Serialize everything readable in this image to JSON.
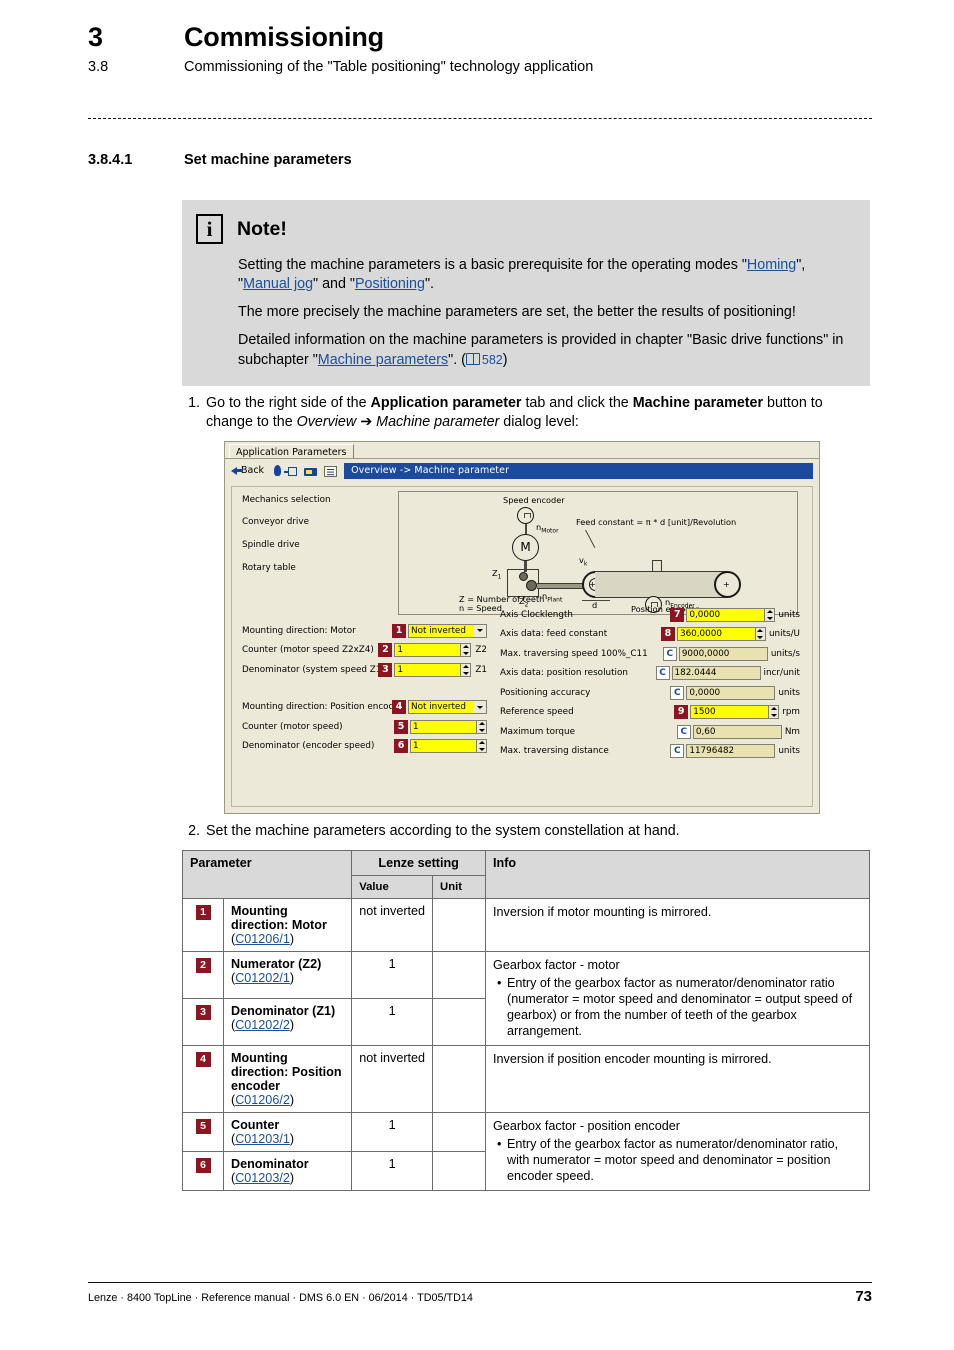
{
  "header": {
    "chapter_number": "3",
    "chapter_title": "Commissioning",
    "section_number": "3.8",
    "section_title": "Commissioning of the \"Table positioning\" technology application"
  },
  "subsection": {
    "number": "3.8.4.1",
    "title": "Set machine parameters"
  },
  "note": {
    "icon": "info-icon",
    "title": "Note!",
    "p1_a": "Setting the machine parameters is a basic prerequisite for the operating modes \"",
    "link_homing": "Homing",
    "p1_b": "\", \"",
    "link_manual_jog": "Manual jog",
    "p1_c": "\" and \"",
    "link_positioning": "Positioning",
    "p1_d": "\".",
    "p2": "The more precisely the machine parameters are set, the better the results of positioning!",
    "p3_a": "Detailed information on the machine parameters is provided in chapter \"Basic drive functions\" in subchapter \"",
    "link_machine_parameters": "Machine parameters",
    "p3_b": "\". (",
    "page_ref": "582",
    "p3_c": ")"
  },
  "steps": {
    "one": {
      "number": "1.",
      "t1": "Go to the right side of the ",
      "b1": "Application parameter",
      "t2": " tab and click the ",
      "b2": "Machine parameter",
      "t3": " button to change to the ",
      "i1": "Overview",
      "t4": " ➔ ",
      "i2": "Machine parameter",
      "t5": " dialog level:"
    },
    "two": {
      "number": "2.",
      "text": "Set the machine parameters according to the system constellation at hand."
    }
  },
  "screenshot": {
    "tab_label": "Application Parameters",
    "toolbar": {
      "back_label": "Back",
      "icons": [
        "back-arrow-icon",
        "bulb-icon",
        "plug-icon",
        "card-icon",
        "properties-icon"
      ],
      "title_bar": "Overview -> Machine parameter",
      "title_bar_color": "#1c4aa0"
    },
    "mechanics": {
      "heading": "Mechanics selection",
      "items": [
        {
          "label": "Conveyor drive",
          "button": "?"
        },
        {
          "label": "Spindle drive",
          "button": "?"
        },
        {
          "label": "Rotary table",
          "button": "?"
        }
      ]
    },
    "diagram": {
      "speed_encoder": "Speed encoder",
      "n_motor": "n",
      "n_motor_sub": "Motor",
      "motor": "M",
      "z1": "Z",
      "z1_sub": "1",
      "z2": "Z",
      "z2_sub": "2",
      "n_plant": "n",
      "n_plant_sub": "Plant",
      "n_encoder": "n",
      "n_encoder_sub": "Encoder",
      "vk": "v",
      "vk_sub": "k",
      "d": "d",
      "position_encoder": "Position encoder",
      "formula": "Feed constant = π * d [unit]/Revolution",
      "legend1": "Z = Number of teeth",
      "legend2": "n = Speed"
    },
    "left_fields": [
      {
        "badge": "1",
        "label": "Mounting direction: Motor",
        "value": "Not inverted",
        "control": "combo",
        "suffix": ""
      },
      {
        "badge": "2",
        "label": "Counter (motor speed Z2xZ4)",
        "value": "1",
        "control": "spin",
        "suffix": "Z2"
      },
      {
        "badge": "3",
        "label": "Denominator (system speed Z1xZ3)",
        "value": "1",
        "control": "spin",
        "suffix": "Z1"
      },
      {
        "badge": "4",
        "label": "Mounting direction: Position encod..",
        "value": "Not inverted",
        "control": "combo",
        "suffix": ""
      },
      {
        "badge": "5",
        "label": "Counter (motor speed)",
        "value": "1",
        "control": "spin",
        "suffix": ""
      },
      {
        "badge": "6",
        "label": "Denominator (encoder speed)",
        "value": "1",
        "control": "spin",
        "suffix": ""
      }
    ],
    "right_fields": [
      {
        "badge": "7",
        "badge_type": "num",
        "label": "Axis Clocklength",
        "value": "0,0000",
        "control": "spin",
        "unit": "units"
      },
      {
        "badge": "8",
        "badge_type": "num",
        "label": "Axis data: feed constant",
        "value": "360,0000",
        "control": "spin",
        "unit": "units/U"
      },
      {
        "badge": "C",
        "badge_type": "c",
        "label": "Max. traversing speed 100%_C11",
        "value": "9000,0000",
        "control": "none",
        "unit": "units/s"
      },
      {
        "badge": "C",
        "badge_type": "c",
        "label": "Axis data: position resolution",
        "value": "182.0444",
        "control": "none",
        "unit": "incr/unit"
      },
      {
        "badge": "C",
        "badge_type": "c",
        "label": "Positioning accuracy",
        "value": "0,0000",
        "control": "none",
        "unit": "units"
      },
      {
        "badge": "9",
        "badge_type": "num",
        "label": "Reference speed",
        "value": "1500",
        "control": "spin",
        "unit": "rpm"
      },
      {
        "badge": "C",
        "badge_type": "c",
        "label": "Maximum torque",
        "value": "0,60",
        "control": "none",
        "unit": "Nm"
      },
      {
        "badge": "C",
        "badge_type": "c",
        "label": "Max. traversing distance",
        "value": "11796482",
        "control": "none",
        "unit": "units"
      }
    ]
  },
  "table": {
    "headers": {
      "parameter": "Parameter",
      "lenze_setting": "Lenze setting",
      "value": "Value",
      "unit": "Unit",
      "info": "Info"
    },
    "rows": [
      {
        "badge": "1",
        "name": "Mounting direction: Motor",
        "code": "C01206/1",
        "value": "not inverted",
        "unit": "",
        "info_title": "Inversion if motor mounting is mirrored.",
        "bullets": []
      },
      {
        "badge": "2",
        "name": "Numerator (Z2)",
        "code": "C01202/1",
        "value": "1",
        "unit": "",
        "info_title": "Gearbox factor - motor",
        "bullets": [
          "Entry of the gearbox factor as numerator/denominator ratio (numerator = motor speed and denominator = output speed of gearbox) or from the number of teeth of the gearbox arrangement."
        ]
      },
      {
        "badge": "3",
        "name": "Denominator (Z1)",
        "code": "C01202/2",
        "value": "1",
        "unit": "",
        "info_title": "",
        "bullets": []
      },
      {
        "badge": "4",
        "name": "Mounting direction: Position encoder",
        "code": "C01206/2",
        "value": "not inverted",
        "unit": "",
        "info_title": "Inversion if position encoder mounting is mirrored.",
        "bullets": []
      },
      {
        "badge": "5",
        "name": "Counter",
        "code": "C01203/1",
        "value": "1",
        "unit": "",
        "info_title": "Gearbox factor - position encoder",
        "bullets": [
          "Entry of the gearbox factor as numerator/denominator ratio, with numerator = motor speed and denominator = position encoder speed."
        ]
      },
      {
        "badge": "6",
        "name": "Denominator",
        "code": "C01203/2",
        "value": "1",
        "unit": "",
        "info_title": "",
        "bullets": []
      }
    ]
  },
  "footer": {
    "left": "Lenze · 8400 TopLine · Reference manual · DMS 6.0 EN · 06/2014 · TD05/TD14",
    "page": "73"
  }
}
